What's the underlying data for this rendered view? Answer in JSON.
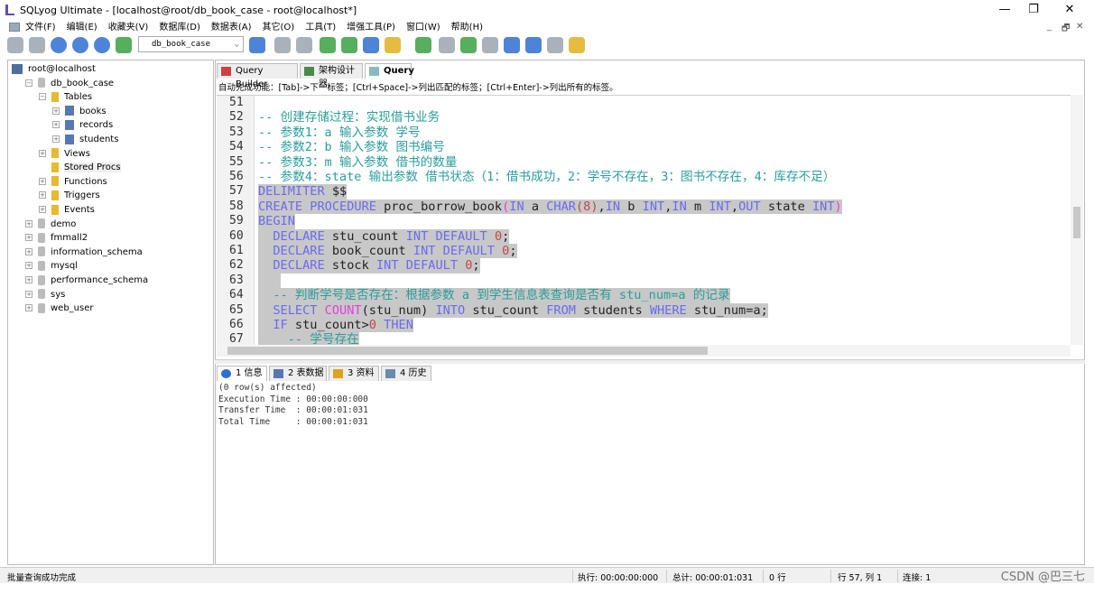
{
  "window": {
    "title": "SQLyog Ultimate - [localhost@root/db_book_case - root@localhost*]",
    "minimize": "—",
    "maximize": "❐",
    "close": "✕",
    "mdi_min": "_",
    "mdi_restore": "🗗",
    "mdi_close": "✕"
  },
  "menu": [
    "文件(F)",
    "编辑(E)",
    "收藏夹(V)",
    "数据库(D)",
    "数据表(A)",
    "其它(O)",
    "工具(T)",
    "增强工具(P)",
    "窗口(W)",
    "帮助(H)"
  ],
  "toolbar": {
    "db_select": "db_book_case",
    "icons": [
      "connect-icon",
      "new-connection-icon",
      "execute-icon",
      "execute-all-icon",
      "refresh-icon",
      "new-query-icon",
      "user-icon",
      "backup-icon",
      "restore-icon",
      "import-icon",
      "export-icon",
      "table-icon",
      "key-icon",
      "schema-sync-icon",
      "data-sync-icon",
      "migrate-icon",
      "job-icon",
      "query-builder-icon",
      "monitor-icon",
      "report-icon",
      "designer-icon"
    ],
    "colors": {
      "blue": "#2f6fd0",
      "green": "#3aa040",
      "gray": "#9aa4ae",
      "yellow": "#e0b020"
    }
  },
  "tree": [
    {
      "label": "root@localhost",
      "level": 0,
      "icon": "host",
      "exp": ""
    },
    {
      "label": "db_book_case",
      "level": 1,
      "icon": "db",
      "exp": "−"
    },
    {
      "label": "Tables",
      "level": 2,
      "icon": "fd",
      "exp": "−"
    },
    {
      "label": "books",
      "level": 3,
      "icon": "tb2",
      "exp": "+"
    },
    {
      "label": "records",
      "level": 3,
      "icon": "tb2",
      "exp": "+"
    },
    {
      "label": "students",
      "level": 3,
      "icon": "tb2",
      "exp": "+"
    },
    {
      "label": "Views",
      "level": 2,
      "icon": "fd",
      "exp": "+"
    },
    {
      "label": "Stored Procs",
      "level": 2,
      "icon": "fd",
      "exp": "",
      "selected": true
    },
    {
      "label": "Functions",
      "level": 2,
      "icon": "fd",
      "exp": "+"
    },
    {
      "label": "Triggers",
      "level": 2,
      "icon": "fd",
      "exp": "+"
    },
    {
      "label": "Events",
      "level": 2,
      "icon": "fd",
      "exp": "+"
    },
    {
      "label": "demo",
      "level": 1,
      "icon": "db",
      "exp": "+"
    },
    {
      "label": "fmmall2",
      "level": 1,
      "icon": "db",
      "exp": "+"
    },
    {
      "label": "information_schema",
      "level": 1,
      "icon": "db",
      "exp": "+"
    },
    {
      "label": "mysql",
      "level": 1,
      "icon": "db",
      "exp": "+"
    },
    {
      "label": "performance_schema",
      "level": 1,
      "icon": "db",
      "exp": "+"
    },
    {
      "label": "sys",
      "level": 1,
      "icon": "db",
      "exp": "+"
    },
    {
      "label": "web_user",
      "level": 1,
      "icon": "db",
      "exp": "+"
    }
  ],
  "tabs": [
    {
      "label": "Query Builder"
    },
    {
      "label": "架构设计器"
    },
    {
      "label": "Query",
      "active": true
    }
  ],
  "hint": "自动完成功能：[Tab]->下一标签；[Ctrl+Space]->列出匹配的标签；[Ctrl+Enter]->列出所有的标签。",
  "editor": {
    "lines": [
      {
        "n": "51",
        "sel": false,
        "t": []
      },
      {
        "n": "52",
        "sel": false,
        "t": [
          [
            "c",
            "-- 创建存储过程：实现借书业务"
          ]
        ]
      },
      {
        "n": "53",
        "sel": false,
        "t": [
          [
            "c",
            "-- 参数1：a 输入参数 学号"
          ]
        ]
      },
      {
        "n": "54",
        "sel": false,
        "t": [
          [
            "c",
            "-- 参数2：b 输入参数 图书编号"
          ]
        ]
      },
      {
        "n": "55",
        "sel": false,
        "t": [
          [
            "c",
            "-- 参数3：m 输入参数 借书的数量"
          ]
        ]
      },
      {
        "n": "56",
        "sel": false,
        "t": [
          [
            "c",
            "-- 参数4：state 输出参数 借书状态（1：借书成功，2：学号不存在，3：图书不存在，4：库存不足）"
          ]
        ]
      },
      {
        "n": "57",
        "sel": true,
        "t": [
          [
            "k",
            "DELIMITER"
          ],
          [
            "p",
            " $$"
          ]
        ]
      },
      {
        "n": "58",
        "sel": true,
        "t": [
          [
            "k",
            "CREATE"
          ],
          [
            "p",
            " "
          ],
          [
            "k",
            "PROCEDURE"
          ],
          [
            "p",
            " proc_borrow_book"
          ],
          [
            "f",
            "("
          ],
          [
            "k",
            "IN"
          ],
          [
            "p",
            " a "
          ],
          [
            "k",
            "CHAR"
          ],
          [
            "n",
            "(8)"
          ],
          [
            "p",
            ","
          ],
          [
            "k",
            "IN"
          ],
          [
            "p",
            " b "
          ],
          [
            "k",
            "INT"
          ],
          [
            "p",
            ","
          ],
          [
            "k",
            "IN"
          ],
          [
            "p",
            " m "
          ],
          [
            "k",
            "INT"
          ],
          [
            "p",
            ","
          ],
          [
            "k",
            "OUT"
          ],
          [
            "p",
            " state "
          ],
          [
            "k",
            "INT"
          ],
          [
            "f",
            ")"
          ]
        ]
      },
      {
        "n": "59",
        "sel": true,
        "t": [
          [
            "k",
            "BEGIN"
          ]
        ]
      },
      {
        "n": "60",
        "sel": true,
        "t": [
          [
            "p",
            "  "
          ],
          [
            "k",
            "DECLARE"
          ],
          [
            "p",
            " stu_count "
          ],
          [
            "k",
            "INT"
          ],
          [
            "p",
            " "
          ],
          [
            "k",
            "DEFAULT"
          ],
          [
            "p",
            " "
          ],
          [
            "n",
            "0"
          ],
          [
            "p",
            ";"
          ]
        ]
      },
      {
        "n": "61",
        "sel": true,
        "t": [
          [
            "p",
            "  "
          ],
          [
            "k",
            "DECLARE"
          ],
          [
            "p",
            " book_count "
          ],
          [
            "k",
            "INT"
          ],
          [
            "p",
            " "
          ],
          [
            "k",
            "DEFAULT"
          ],
          [
            "p",
            " "
          ],
          [
            "n",
            "0"
          ],
          [
            "p",
            ";"
          ]
        ]
      },
      {
        "n": "62",
        "sel": true,
        "t": [
          [
            "p",
            "  "
          ],
          [
            "k",
            "DECLARE"
          ],
          [
            "p",
            " stock "
          ],
          [
            "k",
            "INT"
          ],
          [
            "p",
            " "
          ],
          [
            "k",
            "DEFAULT"
          ],
          [
            "p",
            " "
          ],
          [
            "n",
            "0"
          ],
          [
            "p",
            ";"
          ]
        ]
      },
      {
        "n": "63",
        "sel": true,
        "t": [
          [
            "p",
            "   "
          ]
        ]
      },
      {
        "n": "64",
        "sel": true,
        "t": [
          [
            "p",
            "  "
          ],
          [
            "c",
            "-- 判断学号是否存在：根据参数 a 到学生信息表查询是否有 stu_num=a 的记录"
          ]
        ]
      },
      {
        "n": "65",
        "sel": true,
        "t": [
          [
            "p",
            "  "
          ],
          [
            "k",
            "SELECT"
          ],
          [
            "p",
            " "
          ],
          [
            "f",
            "COUNT"
          ],
          [
            "p",
            "(stu_num) "
          ],
          [
            "k",
            "INTO"
          ],
          [
            "p",
            " stu_count "
          ],
          [
            "k",
            "FROM"
          ],
          [
            "p",
            " students "
          ],
          [
            "k",
            "WHERE"
          ],
          [
            "p",
            " stu_num=a;"
          ]
        ]
      },
      {
        "n": "66",
        "sel": true,
        "t": [
          [
            "p",
            "  "
          ],
          [
            "k",
            "IF"
          ],
          [
            "p",
            " stu_count>"
          ],
          [
            "n",
            "0"
          ],
          [
            "p",
            " "
          ],
          [
            "k",
            "THEN"
          ]
        ]
      },
      {
        "n": "67",
        "sel": true,
        "t": [
          [
            "p",
            "    "
          ],
          [
            "c",
            "-- 学号存在"
          ]
        ]
      }
    ]
  },
  "bottom_tabs": [
    {
      "label": "1 信息",
      "active": true
    },
    {
      "label": "2 表数据"
    },
    {
      "label": "3 资料"
    },
    {
      "label": "4 历史"
    }
  ],
  "results": [
    "(0 row(s) affected)",
    "Execution Time : 00:00:00:000",
    "Transfer Time  : 00:00:01:031",
    "Total Time     : 00:00:01:031"
  ],
  "status": {
    "message": "批量查询成功完成",
    "exec": "执行: 00:00:00:000",
    "total": "总计: 00:00:01:031",
    "rows": "0 行",
    "pos": "行 57, 列 1",
    "conn": "连接: 1"
  },
  "watermark": "CSDN @巴三七"
}
